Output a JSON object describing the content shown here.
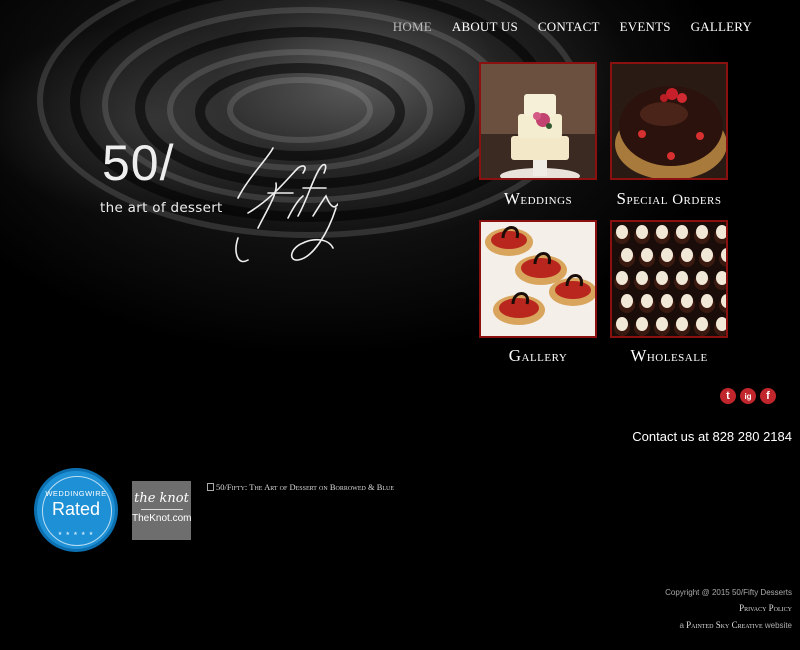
{
  "nav": {
    "items": [
      {
        "label": "HOME"
      },
      {
        "label": "ABOUT US"
      },
      {
        "label": "CONTACT"
      },
      {
        "label": "EVENTS"
      },
      {
        "label": "GALLERY"
      }
    ]
  },
  "logo": {
    "numerals": "50/",
    "script": "Fifty",
    "tagline": "the art of dessert"
  },
  "tiles": [
    {
      "label": "Weddings"
    },
    {
      "label": "Special Orders"
    },
    {
      "label": "Gallery"
    },
    {
      "label": "Wholesale"
    }
  ],
  "social": {
    "twitter": "t",
    "instagram": "ig",
    "facebook": "f"
  },
  "contact": {
    "text": "Contact us at 828 280 2184"
  },
  "badges": {
    "weddingwire_top": "WEDDINGWIRE",
    "weddingwire_main": "Rated",
    "knot_logo": "the knot",
    "knot_site": "TheKnot.com",
    "borrowed_blue_alt": "50/Fifty: The Art of Dessert on Borrowed & Blue"
  },
  "footer": {
    "copyright": "Copyright @ 2015 50/Fifty Desserts",
    "privacy": "Privacy Policy",
    "credit_prefix": "a",
    "credit_name": "Painted Sky Creative",
    "credit_suffix": "website"
  },
  "colors": {
    "tile_border": "#8b1010",
    "social_red": "#c0262b",
    "weddingwire_blue": "#1e90d6",
    "knot_gray": "#6e6e6e"
  }
}
